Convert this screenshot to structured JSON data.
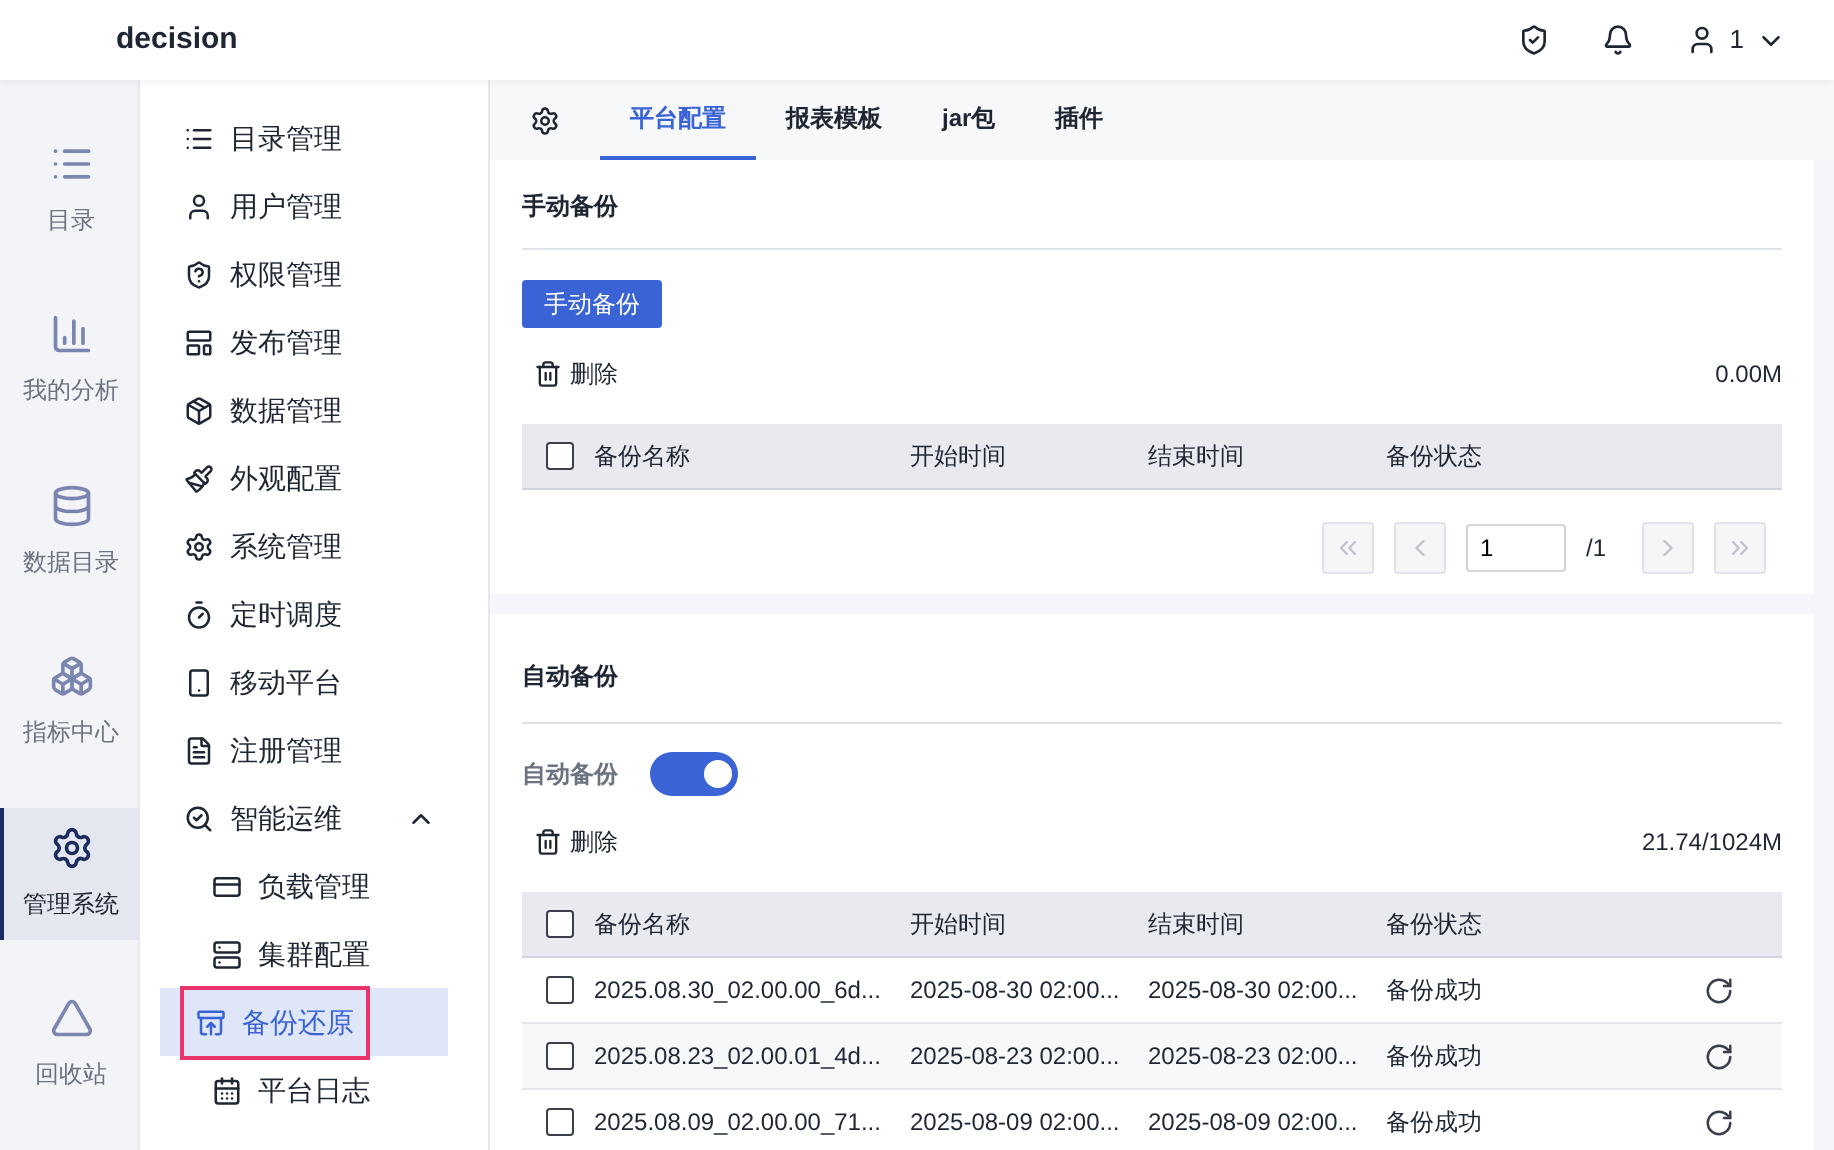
{
  "header": {
    "title": "decision",
    "user": "1"
  },
  "rail": [
    {
      "label": "目录",
      "selected": false
    },
    {
      "label": "我的分析",
      "selected": false
    },
    {
      "label": "数据目录",
      "selected": false
    },
    {
      "label": "指标中心",
      "selected": false
    },
    {
      "label": "管理系统",
      "selected": true
    },
    {
      "label": "回收站",
      "selected": false
    }
  ],
  "nav": [
    {
      "label": "目录管理",
      "selected": false
    },
    {
      "label": "用户管理",
      "selected": false
    },
    {
      "label": "权限管理",
      "selected": false
    },
    {
      "label": "发布管理",
      "selected": false
    },
    {
      "label": "数据管理",
      "selected": false
    },
    {
      "label": "外观配置",
      "selected": false
    },
    {
      "label": "系统管理",
      "selected": false
    },
    {
      "label": "定时调度",
      "selected": false
    },
    {
      "label": "移动平台",
      "selected": false
    },
    {
      "label": "注册管理",
      "selected": false
    },
    {
      "label": "智能运维",
      "selected": false,
      "expanded": true,
      "children": [
        {
          "label": "负载管理",
          "selected": false
        },
        {
          "label": "集群配置",
          "selected": false
        },
        {
          "label": "备份还原",
          "selected": true
        },
        {
          "label": "平台日志",
          "selected": false
        }
      ]
    }
  ],
  "tabs": [
    {
      "label": "平台配置",
      "selected": true
    },
    {
      "label": "报表模板",
      "selected": false
    },
    {
      "label": "jar包",
      "selected": false
    },
    {
      "label": "插件",
      "selected": false
    }
  ],
  "manual": {
    "title": "手动备份",
    "button": "手动备份",
    "delete": "删除",
    "usage": "0.00M",
    "all_checked": false,
    "columns": [
      "备份名称",
      "开始时间",
      "结束时间",
      "备份状态"
    ],
    "pager": {
      "page": "1",
      "total": "/1"
    }
  },
  "auto": {
    "title": "自动备份",
    "toggle_label": "自动备份",
    "on": true,
    "delete": "删除",
    "usage": "21.74/1024M",
    "all_checked": false,
    "columns": [
      "备份名称",
      "开始时间",
      "结束时间",
      "备份状态"
    ],
    "rows": [
      {
        "checked": false,
        "name": "2025.08.30_02.00.00_6d...",
        "start": "2025-08-30 02:00...",
        "end": "2025-08-30 02:00...",
        "status": "备份成功"
      },
      {
        "checked": false,
        "name": "2025.08.23_02.00.01_4d...",
        "start": "2025-08-23 02:00...",
        "end": "2025-08-23 02:00...",
        "status": "备份成功"
      },
      {
        "checked": false,
        "name": "2025.08.09_02.00.00_71...",
        "start": "2025-08-09 02:00...",
        "end": "2025-08-09 02:00...",
        "status": "备份成功"
      }
    ]
  }
}
